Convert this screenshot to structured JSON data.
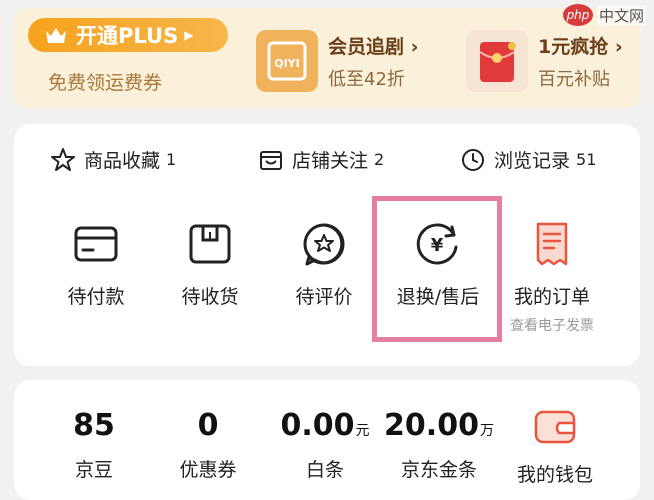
{
  "plus": {
    "pill_label": "开通PLUS",
    "subtitle": "免费领运费券"
  },
  "promos": [
    {
      "title": "会员追剧",
      "sub": "低至42折",
      "icon_text": "QIYI"
    },
    {
      "title": "1元疯抢",
      "sub": "百元补贴"
    }
  ],
  "stats": [
    {
      "label": "商品收藏",
      "count": "1"
    },
    {
      "label": "店铺关注",
      "count": "2"
    },
    {
      "label": "浏览记录",
      "count": "51"
    }
  ],
  "orders": [
    {
      "label": "待付款"
    },
    {
      "label": "待收货"
    },
    {
      "label": "待评价"
    },
    {
      "label": "退换/售后"
    },
    {
      "label": "我的订单",
      "sub": "查看电子发票"
    }
  ],
  "assets": [
    {
      "value": "85",
      "unit": "",
      "label": "京豆"
    },
    {
      "value": "0",
      "unit": "",
      "label": "优惠券"
    },
    {
      "value": "0.00",
      "unit": "元",
      "label": "白条"
    },
    {
      "value": "20.00",
      "unit": "万",
      "label": "京东金条"
    },
    {
      "label": "我的钱包"
    }
  ],
  "watermark": {
    "logo": "php",
    "text": "中文网"
  },
  "colors": {
    "accent_orange": "#f6a21c",
    "highlight_pink": "#e67da3",
    "wallet_red": "#e8553f"
  }
}
